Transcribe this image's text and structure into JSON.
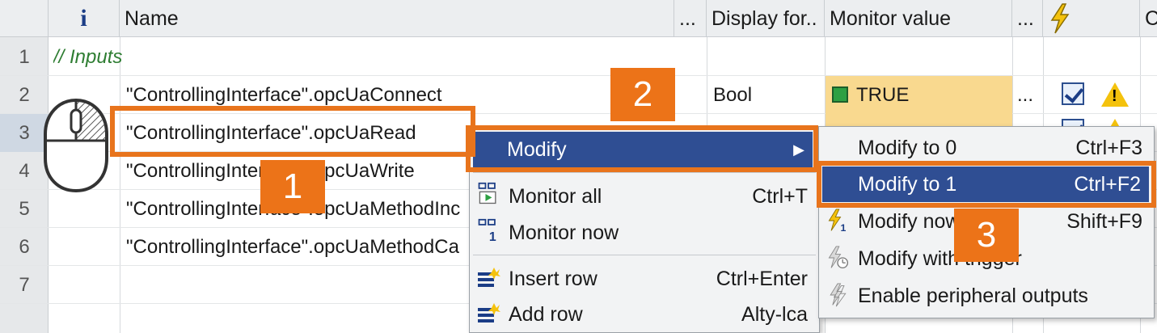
{
  "header": {
    "info": "i",
    "name": "Name",
    "dots1": "...",
    "display_format": "Display for..",
    "monitor_value": "Monitor value",
    "dots2": "...",
    "last": "C"
  },
  "rows": [
    {
      "num": "1",
      "name": "// Inputs",
      "format": "",
      "value": ""
    },
    {
      "num": "2",
      "name": "\"ControllingInterface\".opcUaConnect",
      "format": "Bool",
      "value": "TRUE",
      "value_dots": "..."
    },
    {
      "num": "3",
      "name": "\"ControllingInterface\".opcUaRead",
      "format": "",
      "value": ""
    },
    {
      "num": "4",
      "name": "\"ControllingInterface\".opcUaWrite",
      "format": "",
      "value": ""
    },
    {
      "num": "5",
      "name": "\"ControllingInterface\".opcUaMethodInc",
      "format": "",
      "value": ""
    },
    {
      "num": "6",
      "name": "\"ControllingInterface\".opcUaMethodCa",
      "format": "",
      "value": ""
    },
    {
      "num": "7",
      "name": "",
      "format": "",
      "value": ""
    }
  ],
  "context_menu": {
    "items": [
      {
        "label": "Modify",
        "shortcut": ""
      },
      {
        "label": "Monitor all",
        "shortcut": "Ctrl+T"
      },
      {
        "label": "Monitor now",
        "shortcut": ""
      },
      {
        "label": "Insert row",
        "shortcut": "Ctrl+Enter"
      },
      {
        "label": "Add row",
        "shortcut": "Alty-lca"
      }
    ]
  },
  "submenu": {
    "items": [
      {
        "label": "Modify to 0",
        "shortcut": "Ctrl+F3"
      },
      {
        "label": "Modify to 1",
        "shortcut": "Ctrl+F2"
      },
      {
        "label": "Modify now",
        "shortcut": "Shift+F9"
      },
      {
        "label": "Modify with trigger",
        "shortcut": ""
      },
      {
        "label": "Enable peripheral outputs",
        "shortcut": ""
      }
    ]
  },
  "callouts": {
    "one": "1",
    "two": "2",
    "three": "3"
  },
  "colors": {
    "accent_orange": "#e8741c",
    "menu_highlight": "#2f4e93",
    "monitor_bg": "#f9d98f"
  }
}
